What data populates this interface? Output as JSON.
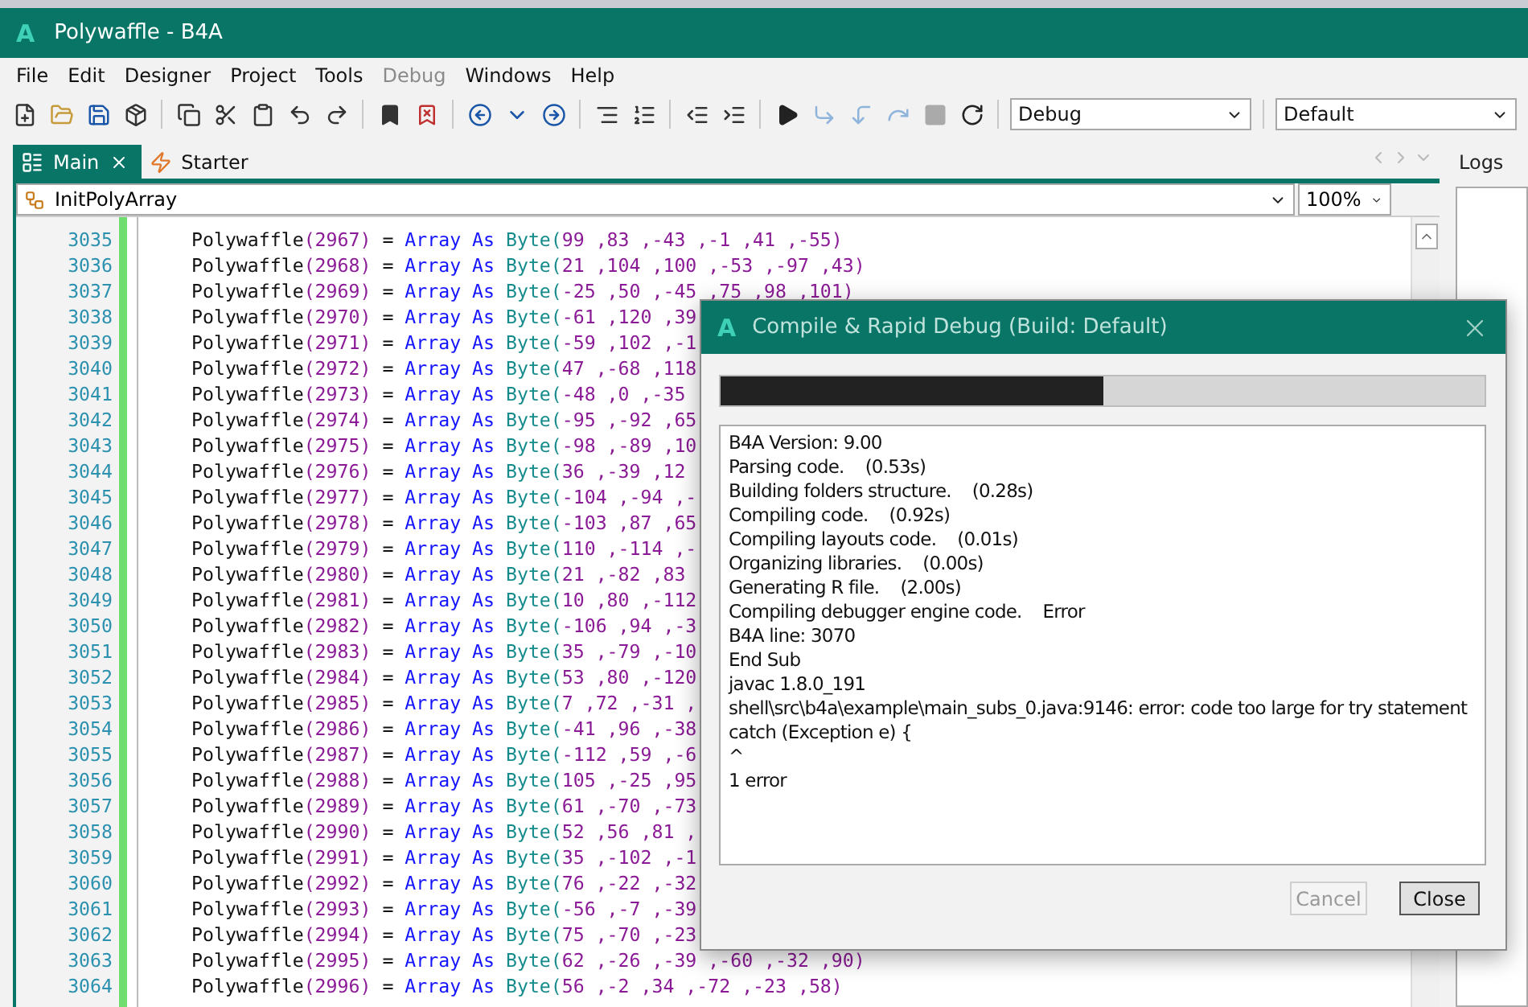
{
  "window": {
    "logo": "A",
    "title": "Polywaffle - B4A"
  },
  "menu": [
    {
      "label": "File",
      "disabled": false
    },
    {
      "label": "Edit",
      "disabled": false
    },
    {
      "label": "Designer",
      "disabled": false
    },
    {
      "label": "Project",
      "disabled": false
    },
    {
      "label": "Tools",
      "disabled": false
    },
    {
      "label": "Debug",
      "disabled": true
    },
    {
      "label": "Windows",
      "disabled": false
    },
    {
      "label": "Help",
      "disabled": false
    }
  ],
  "toolbar": {
    "combos": [
      "Debug",
      "Default"
    ]
  },
  "tabs": [
    {
      "label": "Main",
      "selected": true,
      "kind": "module"
    },
    {
      "label": "Starter",
      "selected": false,
      "kind": "service"
    }
  ],
  "editor": {
    "sub": "InitPolyArray",
    "zoom": "100%",
    "lines": [
      {
        "number": "3035",
        "target": "Polywaffle",
        "index": "(2967)",
        "op": "=",
        "call": "Array As",
        "type": "Byte(",
        "args": "99 ,83 ,-43 ,-1 ,41 ,-55)"
      },
      {
        "number": "3036",
        "target": "Polywaffle",
        "index": "(2968)",
        "op": "=",
        "call": "Array As",
        "type": "Byte(",
        "args": "21 ,104 ,100 ,-53 ,-97 ,43)"
      },
      {
        "number": "3037",
        "target": "Polywaffle",
        "index": "(2969)",
        "op": "=",
        "call": "Array As",
        "type": "Byte(",
        "args": "-25 ,50 ,-45 ,75 ,98 ,101)"
      },
      {
        "number": "3038",
        "target": "Polywaffle",
        "index": "(2970)",
        "op": "=",
        "call": "Array As",
        "type": "Byte(",
        "args": "-61 ,120 ,39"
      },
      {
        "number": "3039",
        "target": "Polywaffle",
        "index": "(2971)",
        "op": "=",
        "call": "Array As",
        "type": "Byte(",
        "args": "-59 ,102 ,-1"
      },
      {
        "number": "3040",
        "target": "Polywaffle",
        "index": "(2972)",
        "op": "=",
        "call": "Array As",
        "type": "Byte(",
        "args": "47 ,-68 ,118"
      },
      {
        "number": "3041",
        "target": "Polywaffle",
        "index": "(2973)",
        "op": "=",
        "call": "Array As",
        "type": "Byte(",
        "args": "-48 ,0 ,-35"
      },
      {
        "number": "3042",
        "target": "Polywaffle",
        "index": "(2974)",
        "op": "=",
        "call": "Array As",
        "type": "Byte(",
        "args": "-95 ,-92 ,65"
      },
      {
        "number": "3043",
        "target": "Polywaffle",
        "index": "(2975)",
        "op": "=",
        "call": "Array As",
        "type": "Byte(",
        "args": "-98 ,-89 ,10"
      },
      {
        "number": "3044",
        "target": "Polywaffle",
        "index": "(2976)",
        "op": "=",
        "call": "Array As",
        "type": "Byte(",
        "args": "36 ,-39 ,12"
      },
      {
        "number": "3045",
        "target": "Polywaffle",
        "index": "(2977)",
        "op": "=",
        "call": "Array As",
        "type": "Byte(",
        "args": "-104 ,-94 ,-"
      },
      {
        "number": "3046",
        "target": "Polywaffle",
        "index": "(2978)",
        "op": "=",
        "call": "Array As",
        "type": "Byte(",
        "args": "-103 ,87 ,65"
      },
      {
        "number": "3047",
        "target": "Polywaffle",
        "index": "(2979)",
        "op": "=",
        "call": "Array As",
        "type": "Byte(",
        "args": "110 ,-114 ,-"
      },
      {
        "number": "3048",
        "target": "Polywaffle",
        "index": "(2980)",
        "op": "=",
        "call": "Array As",
        "type": "Byte(",
        "args": "21 ,-82 ,83"
      },
      {
        "number": "3049",
        "target": "Polywaffle",
        "index": "(2981)",
        "op": "=",
        "call": "Array As",
        "type": "Byte(",
        "args": "10 ,80 ,-112"
      },
      {
        "number": "3050",
        "target": "Polywaffle",
        "index": "(2982)",
        "op": "=",
        "call": "Array As",
        "type": "Byte(",
        "args": "-106 ,94 ,-3"
      },
      {
        "number": "3051",
        "target": "Polywaffle",
        "index": "(2983)",
        "op": "=",
        "call": "Array As",
        "type": "Byte(",
        "args": "35 ,-79 ,-10"
      },
      {
        "number": "3052",
        "target": "Polywaffle",
        "index": "(2984)",
        "op": "=",
        "call": "Array As",
        "type": "Byte(",
        "args": "53 ,80 ,-120"
      },
      {
        "number": "3053",
        "target": "Polywaffle",
        "index": "(2985)",
        "op": "=",
        "call": "Array As",
        "type": "Byte(",
        "args": "7 ,72 ,-31 ,"
      },
      {
        "number": "3054",
        "target": "Polywaffle",
        "index": "(2986)",
        "op": "=",
        "call": "Array As",
        "type": "Byte(",
        "args": "-41 ,96 ,-38"
      },
      {
        "number": "3055",
        "target": "Polywaffle",
        "index": "(2987)",
        "op": "=",
        "call": "Array As",
        "type": "Byte(",
        "args": "-112 ,59 ,-6"
      },
      {
        "number": "3056",
        "target": "Polywaffle",
        "index": "(2988)",
        "op": "=",
        "call": "Array As",
        "type": "Byte(",
        "args": "105 ,-25 ,95"
      },
      {
        "number": "3057",
        "target": "Polywaffle",
        "index": "(2989)",
        "op": "=",
        "call": "Array As",
        "type": "Byte(",
        "args": "61 ,-70 ,-73"
      },
      {
        "number": "3058",
        "target": "Polywaffle",
        "index": "(2990)",
        "op": "=",
        "call": "Array As",
        "type": "Byte(",
        "args": "52 ,56 ,81 ,"
      },
      {
        "number": "3059",
        "target": "Polywaffle",
        "index": "(2991)",
        "op": "=",
        "call": "Array As",
        "type": "Byte(",
        "args": "35 ,-102 ,-1"
      },
      {
        "number": "3060",
        "target": "Polywaffle",
        "index": "(2992)",
        "op": "=",
        "call": "Array As",
        "type": "Byte(",
        "args": "76 ,-22 ,-32"
      },
      {
        "number": "3061",
        "target": "Polywaffle",
        "index": "(2993)",
        "op": "=",
        "call": "Array As",
        "type": "Byte(",
        "args": "-56 ,-7 ,-39"
      },
      {
        "number": "3062",
        "target": "Polywaffle",
        "index": "(2994)",
        "op": "=",
        "call": "Array As",
        "type": "Byte(",
        "args": "75 ,-70 ,-23"
      },
      {
        "number": "3063",
        "target": "Polywaffle",
        "index": "(2995)",
        "op": "=",
        "call": "Array As",
        "type": "Byte(",
        "args": "62 ,-26 ,-39 ,-60 ,-32 ,90)"
      },
      {
        "number": "3064",
        "target": "Polywaffle",
        "index": "(2996)",
        "op": "=",
        "call": "Array As",
        "type": "Byte(",
        "args": "56 ,-2 ,34 ,-72 ,-23 ,58)"
      }
    ]
  },
  "logs_panel": {
    "title": "Logs"
  },
  "dialog": {
    "logo": "A",
    "title": "Compile & Rapid Debug (Build: Default)",
    "progress": {
      "level": 0.5
    },
    "log": [
      "B4A Version: 9.00",
      "Parsing code.    (0.53s)",
      "Building folders structure.    (0.28s)",
      "Compiling code.    (0.92s)",
      "Compiling layouts code.    (0.01s)",
      "Organizing libraries.    (0.00s)",
      "Generating R file.    (2.00s)",
      "Compiling debugger engine code.    Error",
      "B4A line: 3070",
      "End Sub",
      "javac 1.8.0_191",
      "shell\\src\\b4a\\example\\main_subs_0.java:9146: error: code too large for try statement",
      "catch (Exception e) {",
      "^",
      "1 error"
    ],
    "buttons": [
      {
        "label": "Cancel",
        "disabled": true
      },
      {
        "label": "Close",
        "disabled": false
      }
    ]
  }
}
